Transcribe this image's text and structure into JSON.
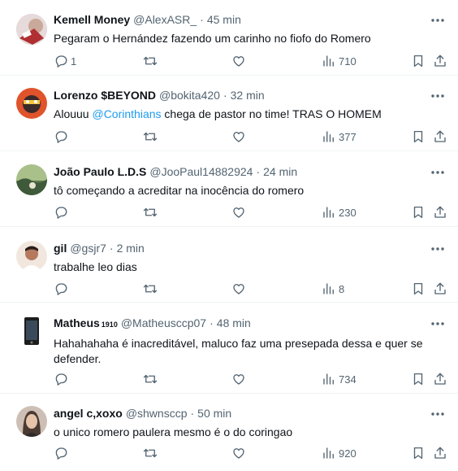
{
  "tweets": [
    {
      "name": "Kemell Money",
      "handle": "@AlexASR_",
      "time": "45 min",
      "text": "Pegaram o Hernández fazendo um carinho no fiofo do Romero",
      "replies": "1",
      "views": "710",
      "avatar_colors": [
        "#d9c6c6",
        "#b02f33"
      ]
    },
    {
      "name": "Lorenzo $BEYOND",
      "handle": "@bokita420",
      "time": "32 min",
      "text_before": "Alouuu ",
      "mention": "@Corinthians",
      "text_after": " chega de pastor no time! TRAS O HOMEM",
      "replies": "",
      "views": "377",
      "avatar_colors": [
        "#e0532b",
        "#3a2a2a"
      ]
    },
    {
      "name": "João Paulo L.D.S",
      "handle": "@JooPaul14882924",
      "time": "24 min",
      "text": "tô começando a acreditar na inocência do romero",
      "replies": "",
      "views": "230",
      "avatar_colors": [
        "#8aa86a",
        "#3f5a3a"
      ]
    },
    {
      "name": "gil",
      "handle": "@gsjr7",
      "time": "2 min",
      "text": "trabalhe leo dias",
      "replies": "",
      "views": "8",
      "avatar_colors": [
        "#e8d9cf",
        "#b57a5e"
      ]
    },
    {
      "name": "Matheus",
      "name_sup": "1910",
      "handle": "@Matheusccp07",
      "time": "48 min",
      "text": "Hahahahaha é inacreditável, maluco faz uma presepada dessa e quer se defender.",
      "replies": "",
      "views": "734",
      "avatar_colors": [
        "#f1f1f1",
        "#1c1c1c"
      ]
    },
    {
      "name": "angel c,xoxo",
      "handle": "@shwnsccp",
      "time": "50 min",
      "text": "o unico romero paulera mesmo é o do coringao",
      "replies": "",
      "views": "920",
      "avatar_colors": [
        "#cdbfb5",
        "#4a3a32"
      ]
    }
  ],
  "separator": "·",
  "colors": {
    "text": "#0f1419",
    "muted": "#536471",
    "link": "#1d9bf0",
    "divider": "#eff3f4"
  },
  "icons": [
    "reply-icon",
    "retweet-icon",
    "like-icon",
    "views-icon",
    "bookmark-icon",
    "share-icon",
    "more-icon"
  ]
}
